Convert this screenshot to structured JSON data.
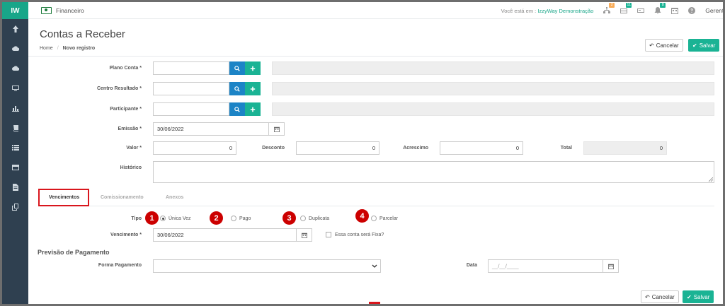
{
  "app": {
    "logo": "IW",
    "module": "Financeiro"
  },
  "topbar": {
    "location_prefix": "Você está em :",
    "location_company": "IzzyWay Demonstração",
    "badges": [
      {
        "icon": "sitemap-icon",
        "count": "2",
        "color": "#f8ac59"
      },
      {
        "icon": "inbox-icon",
        "count": "11",
        "color": "#1ab394"
      },
      {
        "icon": "card-icon",
        "count": "",
        "color": ""
      },
      {
        "icon": "bell-icon",
        "count": "8",
        "color": "#1ab394"
      },
      {
        "icon": "calendar-icon",
        "count": "",
        "color": ""
      },
      {
        "icon": "help-icon",
        "count": "",
        "color": ""
      }
    ],
    "user": "Gerente"
  },
  "sidebar": {
    "icons": [
      "arrow-up-icon",
      "cloud-upload-icon",
      "cloud-download-icon",
      "monitor-icon",
      "bar-chart-icon",
      "book-icon",
      "list-icon",
      "table-icon",
      "document-icon",
      "copy-icon"
    ]
  },
  "header": {
    "title": "Contas a Receber",
    "breadcrumb": {
      "home": "Home",
      "separator": "/",
      "current": "Novo registro"
    }
  },
  "actions": {
    "cancel": "Cancelar",
    "save": "Salvar"
  },
  "form": {
    "plano_conta": {
      "label": "Plano Conta *",
      "value": ""
    },
    "centro_resultado": {
      "label": "Centro Resultado *",
      "value": ""
    },
    "participante": {
      "label": "Participante *",
      "value": ""
    },
    "emissao": {
      "label": "Emissão *",
      "value": "30/06/2022"
    },
    "valor": {
      "label": "Valor *",
      "value": "0"
    },
    "desconto": {
      "label": "Desconto",
      "value": "0"
    },
    "acrescimo": {
      "label": "Acrescimo",
      "value": "0"
    },
    "total": {
      "label": "Total",
      "value": "0"
    },
    "historico": {
      "label": "Histórico",
      "value": ""
    }
  },
  "tabs": [
    {
      "label": "Vencimentos",
      "active": true
    },
    {
      "label": "Comissionamento",
      "active": false
    },
    {
      "label": "Anexos",
      "active": false
    }
  ],
  "vencimentos": {
    "tipo_label": "Tipo",
    "options": [
      {
        "marker": "1",
        "label": "Única Vez",
        "checked": true
      },
      {
        "marker": "2",
        "label": "Pago",
        "checked": false
      },
      {
        "marker": "3",
        "label": "Duplicata",
        "checked": false
      },
      {
        "marker": "4",
        "label": "Parcelar",
        "checked": false
      }
    ],
    "vencimento_label": "Vencimento *",
    "vencimento_value": "30/06/2022",
    "fixa_label": "Essa conta será Fixa?"
  },
  "previsao": {
    "title": "Previsão de Pagamento",
    "forma_label": "Forma Pagamento",
    "forma_value": "",
    "data_label": "Data",
    "data_placeholder": "__/__/____"
  },
  "colors": {
    "accent": "#1ab394",
    "blue": "#1c84c6",
    "sidebar": "#2f4050",
    "highlight": "#d9161d",
    "marker": "#cc0000"
  }
}
